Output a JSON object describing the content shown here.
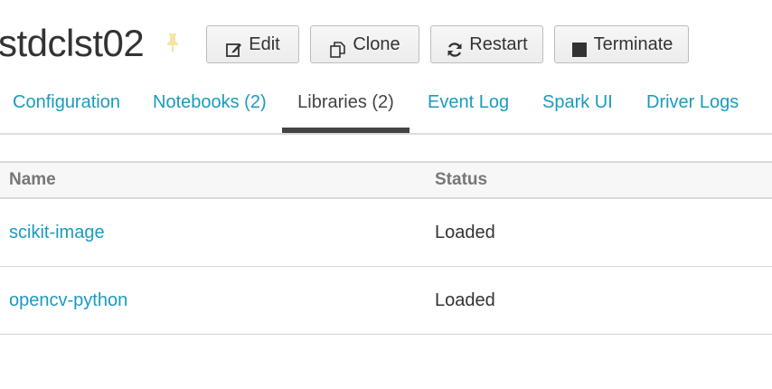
{
  "header": {
    "title": "stdclst02",
    "pin_icon": "pin-icon",
    "pin_color": "#f5e6a8",
    "buttons": {
      "edit": {
        "label": "Edit",
        "icon": "edit-icon"
      },
      "clone": {
        "label": "Clone",
        "icon": "clone-icon"
      },
      "restart": {
        "label": "Restart",
        "icon": "restart-icon"
      },
      "terminate": {
        "label": "Terminate",
        "icon": "stop-icon"
      }
    }
  },
  "tabs": [
    {
      "label": "Configuration",
      "active": false
    },
    {
      "label": "Notebooks (2)",
      "active": false
    },
    {
      "label": "Libraries (2)",
      "active": true
    },
    {
      "label": "Event Log",
      "active": false
    },
    {
      "label": "Spark UI",
      "active": false
    },
    {
      "label": "Driver Logs",
      "active": false
    }
  ],
  "libraries_table": {
    "columns": [
      "Name",
      "Status"
    ],
    "rows": [
      {
        "name": "scikit-image",
        "status": "Loaded"
      },
      {
        "name": "opencv-python",
        "status": "Loaded"
      }
    ]
  },
  "colors": {
    "link": "#1a9bbf",
    "active_tab_underline": "#444444",
    "text": "#333333"
  }
}
